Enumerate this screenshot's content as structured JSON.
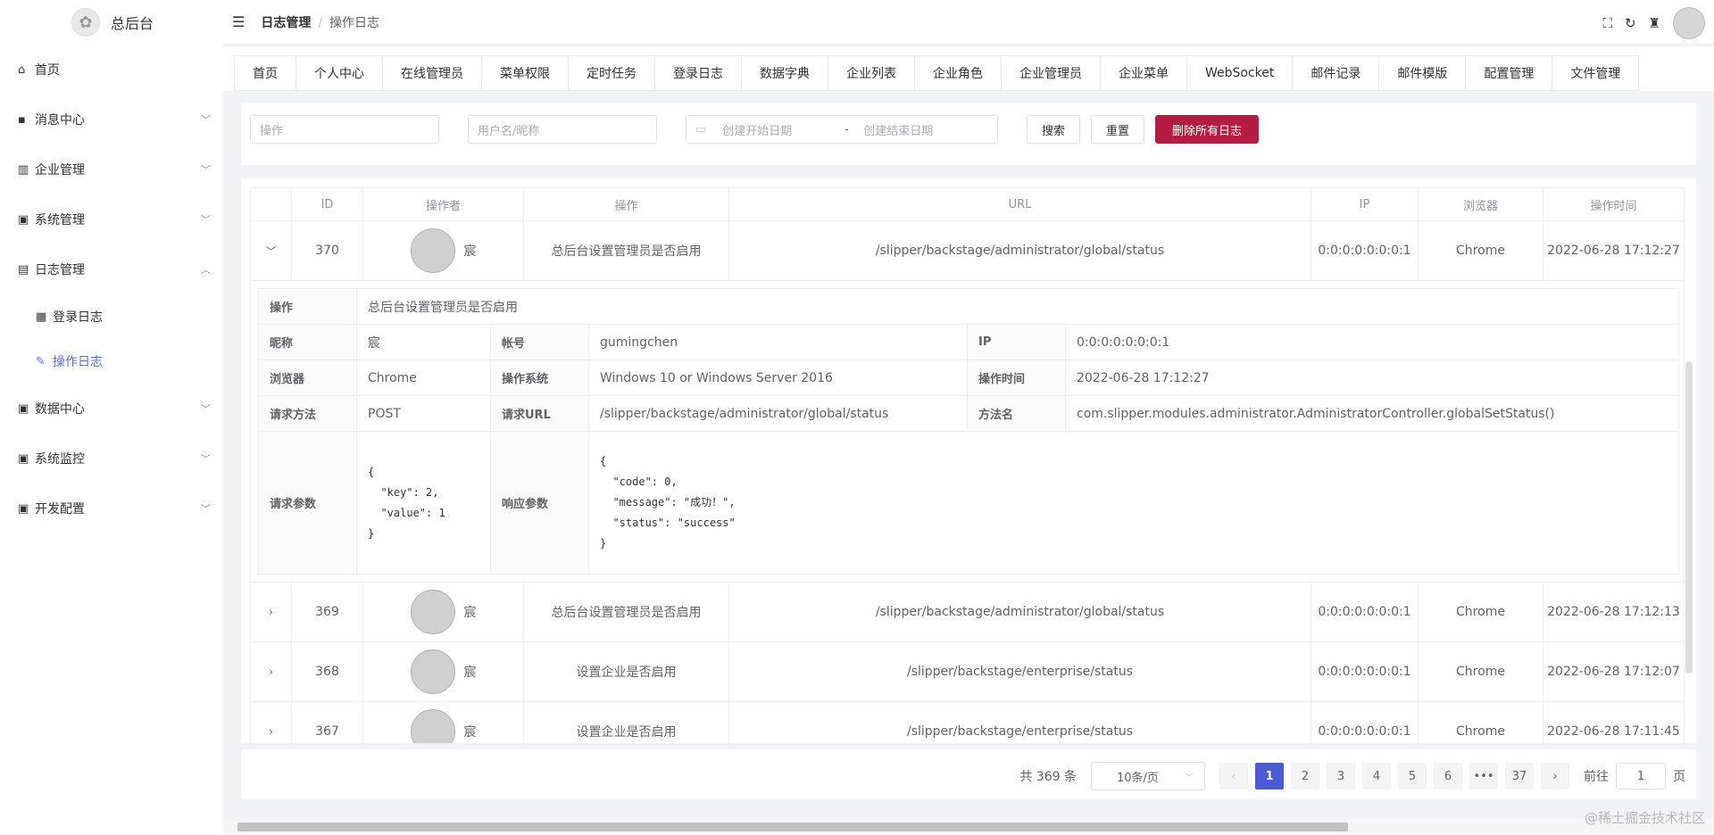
{
  "app": {
    "title": "总后台"
  },
  "sidebar": {
    "items": [
      {
        "label": "首页",
        "icon": "home-icon",
        "expandable": false
      },
      {
        "label": "消息中心",
        "icon": "message-icon",
        "expandable": true
      },
      {
        "label": "企业管理",
        "icon": "chart-icon",
        "expandable": true
      },
      {
        "label": "系统管理",
        "icon": "monitor-icon",
        "expandable": true
      },
      {
        "label": "日志管理",
        "icon": "book-icon",
        "expandable": true,
        "expanded": true,
        "children": [
          {
            "label": "登录日志",
            "icon": "log-icon"
          },
          {
            "label": "操作日志",
            "icon": "edit-icon",
            "active": true
          }
        ]
      },
      {
        "label": "数据中心",
        "icon": "data-icon",
        "expandable": true
      },
      {
        "label": "系统监控",
        "icon": "monitor-icon",
        "expandable": true
      },
      {
        "label": "开发配置",
        "icon": "config-icon",
        "expandable": true
      }
    ]
  },
  "header": {
    "breadcrumb": [
      "日志管理",
      "操作日志"
    ]
  },
  "tabs": [
    "首页",
    "个人中心",
    "在线管理员",
    "菜单权限",
    "定时任务",
    "登录日志",
    "数据字典",
    "企业列表",
    "企业角色",
    "企业管理员",
    "企业菜单",
    "WebSocket",
    "邮件记录",
    "邮件模版",
    "配置管理",
    "文件管理"
  ],
  "search": {
    "operation_placeholder": "操作",
    "user_placeholder": "用户名/昵称",
    "start_placeholder": "创建开始日期",
    "range_sep": "-",
    "end_placeholder": "创建结束日期",
    "search_label": "搜索",
    "reset_label": "重置",
    "delete_all_label": "删除所有日志"
  },
  "table": {
    "headers": [
      "",
      "ID",
      "操作者",
      "操作",
      "URL",
      "IP",
      "浏览器",
      "操作时间"
    ],
    "rows": [
      {
        "id": "370",
        "user": "宸",
        "op": "总后台设置管理员是否启用",
        "url": "/slipper/backstage/administrator/global/status",
        "ip": "0:0:0:0:0:0:0:1",
        "browser": "Chrome",
        "time": "2022-06-28 17:12:27"
      },
      {
        "id": "369",
        "user": "宸",
        "op": "总后台设置管理员是否启用",
        "url": "/slipper/backstage/administrator/global/status",
        "ip": "0:0:0:0:0:0:0:1",
        "browser": "Chrome",
        "time": "2022-06-28 17:12:13"
      },
      {
        "id": "368",
        "user": "宸",
        "op": "设置企业是否启用",
        "url": "/slipper/backstage/enterprise/status",
        "ip": "0:0:0:0:0:0:0:1",
        "browser": "Chrome",
        "time": "2022-06-28 17:12:07"
      },
      {
        "id": "367",
        "user": "宸",
        "op": "设置企业是否启用",
        "url": "/slipper/backstage/enterprise/status",
        "ip": "0:0:0:0:0:0:0:1",
        "browser": "Chrome",
        "time": "2022-06-28 17:11:45"
      }
    ]
  },
  "detail": {
    "op_label": "操作",
    "op_value": "总后台设置管理员是否启用",
    "nick_label": "昵称",
    "nick_value": "宸",
    "account_label": "帐号",
    "account_value": "gumingchen",
    "ip_label": "IP",
    "ip_value": "0:0:0:0:0:0:0:1",
    "browser_label": "浏览器",
    "browser_value": "Chrome",
    "os_label": "操作系统",
    "os_value": "Windows 10 or Windows Server 2016",
    "time_label": "操作时间",
    "time_value": "2022-06-28 17:12:27",
    "method_label": "请求方法",
    "method_value": "POST",
    "url_label": "请求URL",
    "url_value": "/slipper/backstage/administrator/global/status",
    "fn_label": "方法名",
    "fn_value": "com.slipper.modules.administrator.AdministratorController.globalSetStatus()",
    "params_label": "请求参数",
    "params_value": "{\n  \"key\": 2,\n  \"value\": 1\n}",
    "resp_label": "响应参数",
    "resp_value": "{\n  \"code\": 0,\n  \"message\": \"成功！\",\n  \"status\": \"success\"\n}"
  },
  "pagination": {
    "total": "共 369 条",
    "page_size": "10条/页",
    "pages": [
      "1",
      "2",
      "3",
      "4",
      "5",
      "6",
      "•••",
      "37"
    ],
    "current": "1",
    "jump_label": "前往",
    "jump_value": "1",
    "page_unit": "页"
  },
  "watermark": "@稀土掘金技术社区",
  "colors": {
    "accent": "#4b5bd6",
    "danger": "#b61b41",
    "active_menu": "#5a6ed6"
  }
}
